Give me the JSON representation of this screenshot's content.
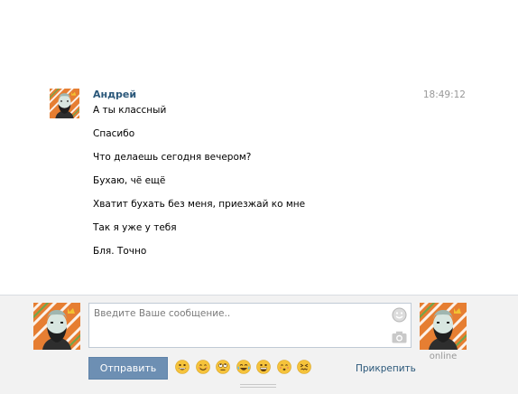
{
  "message": {
    "author": "Андрей",
    "time": "18:49:12",
    "lines": [
      "А ты классный",
      "Спасибо",
      "Что делаешь сегодня вечером?",
      "Бухаю, чё ещё",
      "Хватит бухать без меня, приезжай ко мне",
      "Так я уже у тебя",
      "Бля. Точно"
    ]
  },
  "compose": {
    "placeholder": "Введите Ваше сообщение..",
    "value": "",
    "send_label": "Отправить",
    "attach_label": "Прикрепить",
    "peer_status": "online",
    "emojis": [
      "grinning-emoji",
      "smiling-emoji",
      "eye-roll-emoji",
      "tears-of-joy-emoji",
      "big-grin-emoji",
      "kissing-emoji",
      "confounded-emoji"
    ]
  },
  "colors": {
    "author_link": "#2b587a",
    "send_button": "#6d8fb3",
    "panel_bg": "#f2f2f2",
    "timestamp": "#999999"
  }
}
